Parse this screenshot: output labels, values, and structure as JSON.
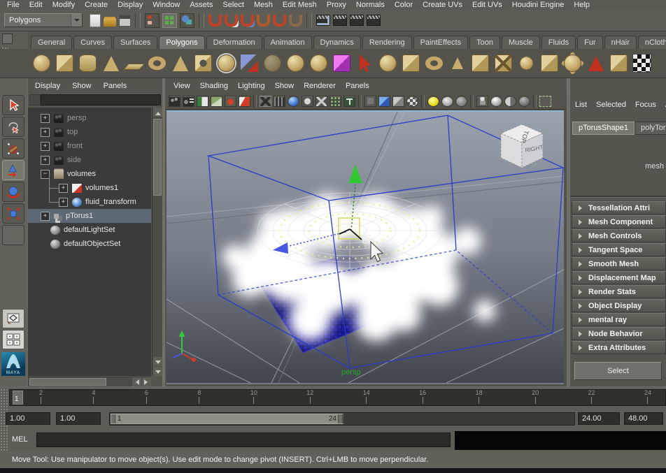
{
  "menubar": {
    "items": [
      "File",
      "Edit",
      "Modify",
      "Create",
      "Display",
      "Window",
      "Assets",
      "Select",
      "Mesh",
      "Edit Mesh",
      "Proxy",
      "Normals",
      "Color",
      "Create UVs",
      "Edit UVs",
      "Houdini Engine",
      "Help"
    ]
  },
  "statusline": {
    "mode_selector": "Polygons",
    "icons": [
      "new-scene",
      "open-scene",
      "save-scene",
      "sep",
      "select-hierarchy",
      "select-object",
      "select-component",
      "sep",
      "snap-grid",
      "snap-curve",
      "snap-point",
      "snap-projected",
      "snap-view",
      "make-live",
      "sep",
      "render-view",
      "render-current",
      "render-ipr",
      "render-settings"
    ]
  },
  "shelf": {
    "tabs": [
      {
        "label": "General",
        "cls": ""
      },
      {
        "label": "Curves",
        "cls": ""
      },
      {
        "label": "Surfaces",
        "cls": ""
      },
      {
        "label": "Polygons",
        "cls": "active"
      },
      {
        "label": "Deformation",
        "cls": ""
      },
      {
        "label": "Animation",
        "cls": ""
      },
      {
        "label": "Dynamics",
        "cls": ""
      },
      {
        "label": "Rendering",
        "cls": ""
      },
      {
        "label": "PaintEffects",
        "cls": ""
      },
      {
        "label": "Toon",
        "cls": ""
      },
      {
        "label": "Muscle",
        "cls": ""
      },
      {
        "label": "Fluids",
        "cls": ""
      },
      {
        "label": "Fur",
        "cls": ""
      },
      {
        "label": "nHair",
        "cls": ""
      },
      {
        "label": "nCloth",
        "cls": ""
      }
    ],
    "icons": [
      "sphere",
      "cube",
      "cylinder",
      "cone",
      "plane",
      "torus",
      "pyramid",
      "pipe",
      "platonic",
      "plane-arrow",
      "ghost-sphere",
      "sphere-project",
      "sphere-multi",
      "purple-cube",
      "cursor-red",
      "sphere-wire",
      "cube-wire",
      "torus-wire",
      "cone-small",
      "cube-combine",
      "cube-x",
      "sphere-small",
      "cube-dup",
      "spike-ball",
      "red-cone",
      "cube-pair",
      "checker-flag"
    ]
  },
  "toolbox": {
    "tools": [
      "select",
      "lasso",
      "paint-select",
      "move",
      "rotate",
      "scale"
    ],
    "active_tool": "move",
    "layout_buttons": [
      "single-pane",
      "four-pane"
    ],
    "logo_label": "MAYA"
  },
  "outliner": {
    "menus": [
      "Display",
      "Show",
      "Panels"
    ],
    "search_value": "",
    "items": [
      {
        "label": "persp",
        "exp": "+",
        "icon": "camera",
        "cls": "muted"
      },
      {
        "label": "top",
        "exp": "+",
        "icon": "camera",
        "cls": "muted"
      },
      {
        "label": "front",
        "exp": "+",
        "icon": "camera",
        "cls": "muted"
      },
      {
        "label": "side",
        "exp": "+",
        "icon": "camera",
        "cls": "muted"
      },
      {
        "label": "volumes",
        "exp": "−",
        "icon": "folder",
        "cls": ""
      },
      {
        "label": "volumes1",
        "exp": "+",
        "icon": "flag",
        "cls": "child"
      },
      {
        "label": "fluid_transform",
        "exp": "+",
        "icon": "fluid",
        "cls": "child"
      },
      {
        "label": "pTorus1",
        "exp": "+",
        "icon": "mesh",
        "cls": "selected"
      },
      {
        "label": "defaultLightSet",
        "exp": "",
        "icon": "set",
        "cls": "set"
      },
      {
        "label": "defaultObjectSet",
        "exp": "",
        "icon": "set",
        "cls": "set"
      }
    ]
  },
  "viewport": {
    "menus": [
      "View",
      "Shading",
      "Lighting",
      "Show",
      "Renderer",
      "Panels"
    ],
    "toolbar_icons": [
      "movie-camera",
      "camera-attrs",
      "bookmark-book",
      "image-plane",
      "paint-red",
      "eraser-red",
      "sep",
      "wireframe-box",
      "film-box",
      "blue-sphere",
      "circle-box",
      "x-box",
      "dots-box",
      "t-box",
      "sep",
      "cube-outline",
      "blue-cube",
      "shaded-cube",
      "checker-ball",
      "sep",
      "yellow-light",
      "gray-light",
      "dim-light",
      "sep",
      "person-view",
      "lit-ball",
      "half-ball",
      "dark-ball",
      "sep",
      "marquee-cursor"
    ],
    "scene": {
      "camera_label": "persp",
      "view_cube": {
        "top_face": "TOP",
        "right_face": "RIGHT"
      },
      "selected_object": "pTorus1"
    }
  },
  "attribute_editor": {
    "menus": [
      "List",
      "Selected",
      "Focus",
      "A"
    ],
    "tabs": [
      {
        "label": "pTorusShape1",
        "cls": "active"
      },
      {
        "label": "polyTor",
        "cls": ""
      }
    ],
    "focus_type": "mesh",
    "sections": [
      "Tessellation Attri",
      "Mesh Component",
      "Mesh Controls",
      "Tangent Space",
      "Smooth Mesh",
      "Displacement Map",
      "Render Stats",
      "Object Display",
      "mental ray",
      "Node Behavior",
      "Extra Attributes"
    ],
    "select_button": "Select"
  },
  "timeline": {
    "ticks": [
      "2",
      "4",
      "6",
      "8",
      "10",
      "12",
      "14",
      "16",
      "18",
      "20",
      "22",
      "24"
    ],
    "current_frame": "1"
  },
  "range_slider": {
    "left1": "1.00",
    "left2": "1.00",
    "bar_start": "1",
    "bar_end": "24",
    "right1": "24.00",
    "right2": "48.00"
  },
  "command_line": {
    "label": "MEL",
    "value": ""
  },
  "help_line": {
    "text": "Move Tool: Use manipulator to move object(s). Use edit mode to change pivot (INSERT).  Ctrl+LMB to move perpendicular."
  },
  "colors": {
    "selected_row": "#5c6874",
    "viewport_top": "#9aa2ae",
    "viewport_bottom": "#41454d",
    "container_blue": "#2a3cc8",
    "manipulator_green": "#28c828",
    "persp_label_green": "#22aa22",
    "fluid_plane_blue": "#1c1cb4"
  }
}
